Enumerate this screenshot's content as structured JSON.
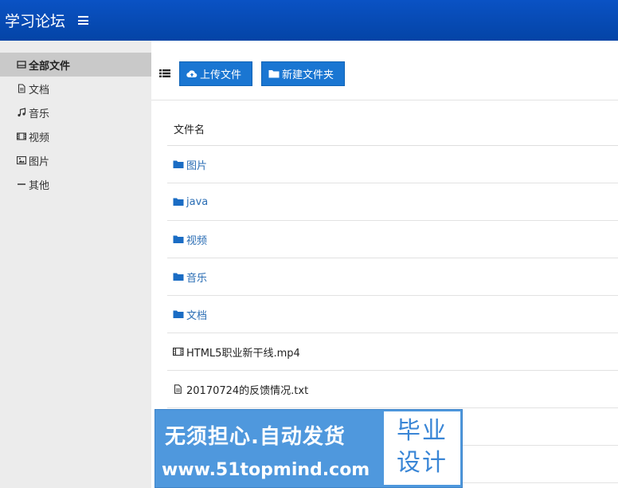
{
  "header": {
    "brand": "学习论坛",
    "menu_icon": "hamburger-menu-icon"
  },
  "sidebar": {
    "items": [
      {
        "label": "全部文件",
        "icon": "all-files-icon",
        "active": true
      },
      {
        "label": "文档",
        "icon": "document-icon",
        "active": false
      },
      {
        "label": "音乐",
        "icon": "music-note-icon",
        "active": false
      },
      {
        "label": "视频",
        "icon": "film-icon",
        "active": false
      },
      {
        "label": "图片",
        "icon": "picture-icon",
        "active": false
      },
      {
        "label": "其他",
        "icon": "minus-icon",
        "active": false
      }
    ]
  },
  "toolbar": {
    "view_icon": "list-view-icon",
    "upload_label": "上传文件",
    "new_folder_label": "新建文件夹"
  },
  "file_list": {
    "column_header": "文件名",
    "rows": [
      {
        "name": "图片",
        "type": "folder",
        "icon": "folder-icon"
      },
      {
        "name": "java",
        "type": "folder",
        "icon": "folder-icon"
      },
      {
        "name": "视频",
        "type": "folder",
        "icon": "folder-icon"
      },
      {
        "name": "音乐",
        "type": "folder",
        "icon": "folder-icon"
      },
      {
        "name": "文档",
        "type": "folder",
        "icon": "folder-icon"
      },
      {
        "name": "HTML5职业新干线.mp4",
        "type": "file",
        "icon": "video-file-icon"
      },
      {
        "name": "20170724的反馈情况.txt",
        "type": "file",
        "icon": "text-file-icon"
      },
      {
        "name": "",
        "type": "file",
        "icon": ""
      },
      {
        "name": "",
        "type": "file",
        "icon": ""
      }
    ]
  },
  "watermark": {
    "slogan": "无须担心.自动发货",
    "url": "www.51topmind.com",
    "stamp_line1": "毕业",
    "stamp_line2": "设计"
  },
  "colors": {
    "header_bg": "#0a52c4",
    "button_bg": "#1a76d2",
    "folder_link": "#2a6db4",
    "sidebar_bg": "#ececec",
    "sidebar_active_bg": "#c9c9c9",
    "watermark_bg": "#4f98dd"
  }
}
